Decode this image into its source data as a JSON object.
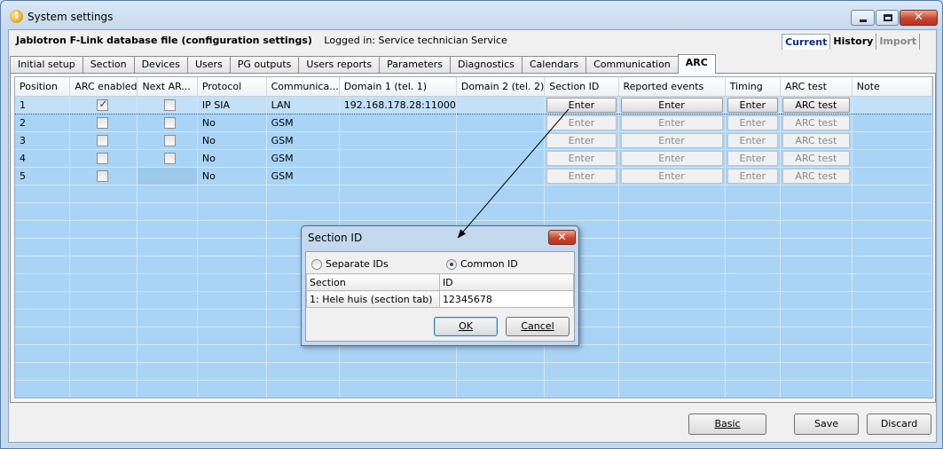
{
  "window": {
    "title": "System settings",
    "minimize_icon": "minimize-icon",
    "maximize_icon": "maximize-icon",
    "close_symbol": "✕"
  },
  "header": {
    "file_label": "Jablotron F-Link database file (configuration settings)",
    "login_text": "Logged in: Service technician Service"
  },
  "mode_tabs": [
    {
      "label": "Current",
      "state": "active"
    },
    {
      "label": "History",
      "state": "normal"
    },
    {
      "label": "Import",
      "state": "disabled"
    }
  ],
  "tabs": [
    {
      "label": "Initial setup"
    },
    {
      "label": "Section"
    },
    {
      "label": "Devices"
    },
    {
      "label": "Users"
    },
    {
      "label": "PG outputs"
    },
    {
      "label": "Users reports"
    },
    {
      "label": "Parameters"
    },
    {
      "label": "Diagnostics"
    },
    {
      "label": "Calendars"
    },
    {
      "label": "Communication"
    },
    {
      "label": "ARC",
      "active": true
    }
  ],
  "grid": {
    "columns": [
      "Position",
      "ARC enabled",
      "Next AR...",
      "Protocol",
      "Communica...",
      "Domain 1 (tel. 1)",
      "Domain 2 (tel. 2)",
      "Section ID",
      "Reported events",
      "Timing",
      "ARC test",
      "Note"
    ],
    "rows": [
      {
        "position": "1",
        "arc_enabled": true,
        "next_arc": false,
        "protocol": "IP SIA",
        "communication": "LAN",
        "domain1": "192.168.178.28:11000",
        "domain2": "",
        "section_id": "Enter",
        "reported_events": "Enter",
        "timing": "Enter",
        "arc_test": "ARC test",
        "note": "",
        "selected": true
      },
      {
        "position": "2",
        "arc_enabled": false,
        "next_arc": false,
        "protocol": "No",
        "communication": "GSM",
        "domain1": "",
        "domain2": "",
        "section_id": "Enter",
        "reported_events": "Enter",
        "timing": "Enter",
        "arc_test": "ARC test",
        "note": ""
      },
      {
        "position": "3",
        "arc_enabled": false,
        "next_arc": false,
        "protocol": "No",
        "communication": "GSM",
        "domain1": "",
        "domain2": "",
        "section_id": "Enter",
        "reported_events": "Enter",
        "timing": "Enter",
        "arc_test": "ARC test",
        "note": ""
      },
      {
        "position": "4",
        "arc_enabled": false,
        "next_arc": false,
        "protocol": "No",
        "communication": "GSM",
        "domain1": "",
        "domain2": "",
        "section_id": "Enter",
        "reported_events": "Enter",
        "timing": "Enter",
        "arc_test": "ARC test",
        "note": ""
      },
      {
        "position": "5",
        "arc_enabled": false,
        "next_arc": null,
        "protocol": "No",
        "communication": "GSM",
        "domain1": "",
        "domain2": "",
        "section_id": "Enter",
        "reported_events": "Enter",
        "timing": "Enter",
        "arc_test": "ARC test",
        "note": ""
      }
    ],
    "empty_rows": 12
  },
  "footer": {
    "basic_label": "Basic",
    "save_label": "Save",
    "discard_label": "Discard"
  },
  "dialog": {
    "title": "Section ID",
    "close_symbol": "✕",
    "radio_separate": "Separate IDs",
    "radio_common": "Common ID",
    "selected_radio": "common",
    "col_section": "Section",
    "col_id": "ID",
    "row_section": "1: Hele huis (section tab)",
    "row_id": "12345678",
    "ok_label": "OK",
    "cancel_label": "Cancel"
  },
  "colors": {
    "grid_background": "#a9d4f5",
    "window_frame": "#c4d8ee",
    "close_button": "#c8452f",
    "annotation_arrow": "#000000"
  }
}
